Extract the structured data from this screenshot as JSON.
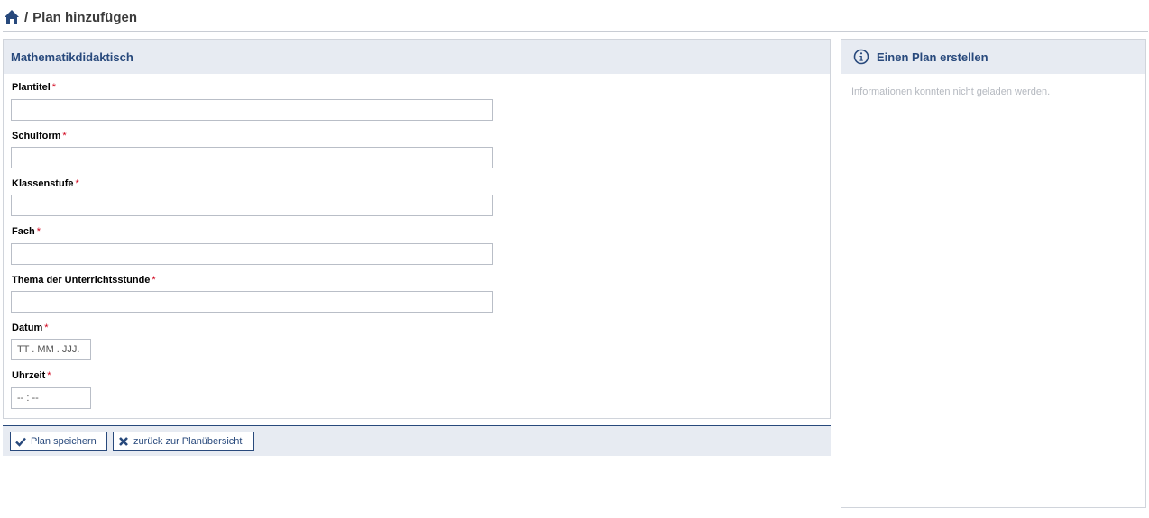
{
  "breadcrumb": {
    "separator": "/",
    "title": "Plan hinzufügen",
    "home_icon": "home-icon"
  },
  "form": {
    "title": "Mathematikdidaktisch",
    "required_marker": "*",
    "fields": [
      {
        "label": "Plantitel",
        "value": "",
        "placeholder": ""
      },
      {
        "label": "Schulform",
        "value": "",
        "placeholder": ""
      },
      {
        "label": "Klassenstufe",
        "value": "",
        "placeholder": ""
      },
      {
        "label": "Fach",
        "value": "",
        "placeholder": ""
      },
      {
        "label": "Thema der Unterrichtsstunde",
        "value": "",
        "placeholder": ""
      },
      {
        "label": "Datum",
        "value": "",
        "placeholder": "TT . MM . JJJ."
      },
      {
        "label": "Uhrzeit",
        "value": "",
        "placeholder": "-- : --"
      }
    ]
  },
  "actions": {
    "save_label": "Plan speichern",
    "save_icon": "check-icon",
    "back_label": "zurück zur Planübersicht",
    "back_icon": "close-icon"
  },
  "side": {
    "title": "Einen Plan erstellen",
    "icon": "info-icon",
    "message": "Informationen konnten nicht geladen werden."
  },
  "colors": {
    "accent": "#28497c",
    "header_bg": "#e7ebf2",
    "required": "#d0021b"
  }
}
